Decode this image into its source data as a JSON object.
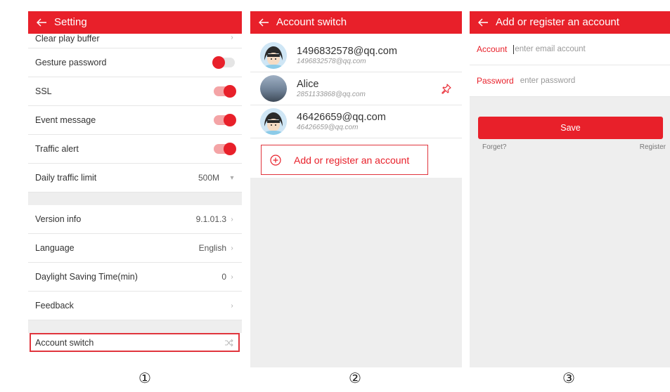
{
  "screen1": {
    "title": "Setting",
    "rows": {
      "clear_play_buffer": "Clear play buffer",
      "gesture_password": "Gesture password",
      "ssl": "SSL",
      "event_message": "Event message",
      "traffic_alert": "Traffic alert",
      "daily_traffic_limit": "Daily traffic limit",
      "daily_traffic_value": "500M",
      "version_info": "Version info",
      "version_value": "9.1.01.3",
      "language": "Language",
      "language_value": "English",
      "dst": "Daylight Saving Time(min)",
      "dst_value": "0",
      "feedback": "Feedback",
      "account_switch": "Account switch"
    },
    "toggles": {
      "gesture_password": false,
      "ssl": true,
      "event_message": true,
      "traffic_alert": true
    }
  },
  "screen2": {
    "title": "Account switch",
    "accounts": [
      {
        "name": "1496832578@qq.com",
        "email": "1496832578@qq.com"
      },
      {
        "name": "Alice",
        "email": "2851133868@qq.com"
      },
      {
        "name": "46426659@qq.com",
        "email": "46426659@qq.com"
      }
    ],
    "add_account": "Add or register an account"
  },
  "screen3": {
    "title": "Add or register an account",
    "account_label": "Account",
    "account_placeholder": "enter email account",
    "password_label": "Password",
    "password_placeholder": "enter password",
    "save": "Save",
    "forget": "Forget?",
    "register": "Register"
  },
  "captions": [
    "①",
    "②",
    "③"
  ],
  "colors": {
    "accent": "#e8202a",
    "toggle_track_on": "#f4a4a6",
    "background_gray": "#eeeeee"
  }
}
